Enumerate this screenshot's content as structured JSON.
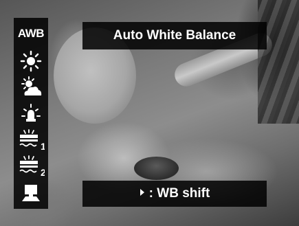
{
  "screen": {
    "title": "Auto White Balance",
    "hint_key_icon": "right-arrow-icon",
    "hint_text": ": WB shift"
  },
  "wb_menu": {
    "items": [
      {
        "id": "awb",
        "label": "AWB",
        "icon": "awb-icon",
        "selected": true
      },
      {
        "id": "daylight",
        "icon": "sun-icon"
      },
      {
        "id": "cloudy",
        "icon": "cloudy-icon"
      },
      {
        "id": "tungsten",
        "icon": "tungsten-bulb-icon"
      },
      {
        "id": "fluorescent1",
        "label": "1",
        "icon": "fluorescent-1-icon"
      },
      {
        "id": "fluorescent2",
        "label": "2",
        "icon": "fluorescent-2-icon"
      },
      {
        "id": "custom",
        "icon": "custom-wb-icon"
      }
    ]
  },
  "colors": {
    "overlay": "#000000",
    "text": "#ffffff"
  }
}
